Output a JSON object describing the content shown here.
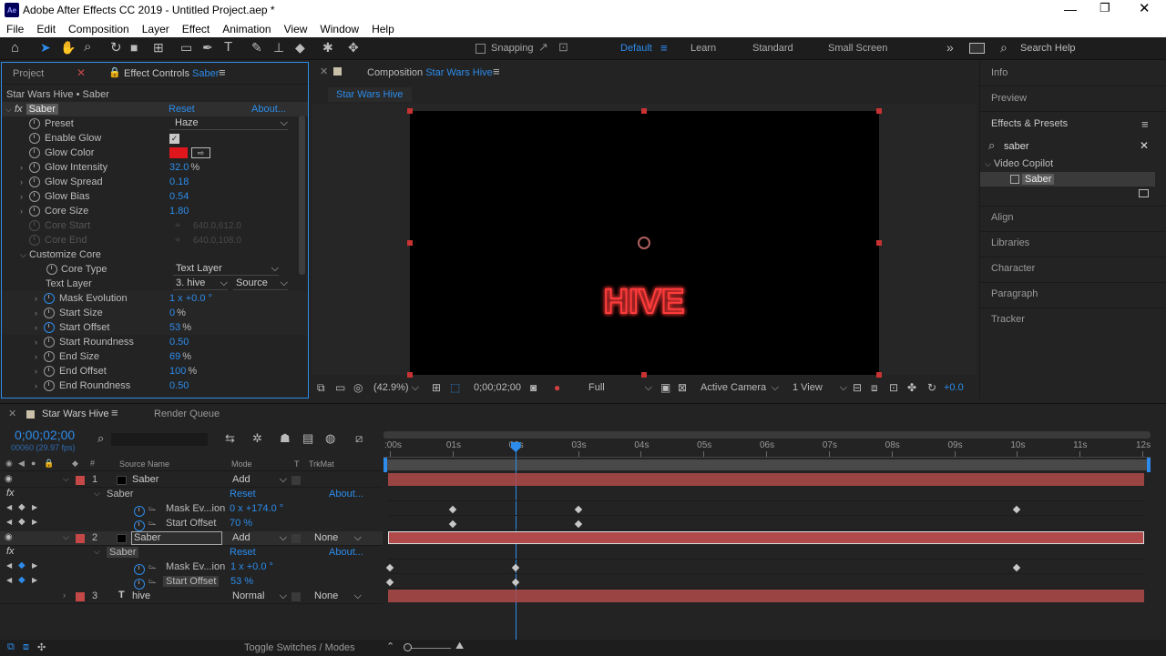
{
  "titlebar": {
    "title": "Adobe After Effects CC 2019 - Untitled Project.aep *",
    "app_icon": "Ae"
  },
  "menu": [
    "File",
    "Edit",
    "Composition",
    "Layer",
    "Effect",
    "Animation",
    "View",
    "Window",
    "Help"
  ],
  "toolbar": {
    "snapping": "Snapping",
    "workspaces": [
      "Default",
      "Learn",
      "Standard",
      "Small Screen"
    ],
    "search_placeholder": "Search Help",
    "more": "»"
  },
  "left_panel": {
    "tab_project": "Project",
    "tab_effect_controls_prefix": "Effect Controls",
    "tab_effect_controls_layer": "Saber",
    "layer_path": "Star Wars Hive • Saber",
    "effect_name": "Saber",
    "reset": "Reset",
    "about": "About...",
    "props": [
      {
        "label": "Preset",
        "value": "Haze",
        "kind": "select"
      },
      {
        "label": "Enable Glow",
        "value": "✓",
        "kind": "check"
      },
      {
        "label": "Glow Color",
        "value": "",
        "kind": "color"
      },
      {
        "label": "Glow Intensity",
        "value": "32.0",
        "unit": "%"
      },
      {
        "label": "Glow Spread",
        "value": "0.18"
      },
      {
        "label": "Glow Bias",
        "value": "0.54"
      },
      {
        "label": "Core Size",
        "value": "1.80"
      },
      {
        "label": "Core Start",
        "value": "640.0,612.0",
        "kind": "disabled"
      },
      {
        "label": "Core End",
        "value": "640.0,108.0",
        "kind": "disabled"
      }
    ],
    "customize_core": "Customize Core",
    "core_type_label": "Core Type",
    "core_type_value": "Text Layer",
    "text_layer_label": "Text Layer",
    "text_layer_value": "3. hive",
    "text_layer_source": "Source",
    "core_props": [
      {
        "label": "Mask Evolution",
        "value": "1 x +0.0 °"
      },
      {
        "label": "Start Size",
        "value": "0",
        "unit": "%"
      },
      {
        "label": "Start Offset",
        "value": "53",
        "unit": "%"
      },
      {
        "label": "Start Roundness",
        "value": "0.50"
      },
      {
        "label": "End Size",
        "value": "69",
        "unit": "%"
      },
      {
        "label": "End Offset",
        "value": "100",
        "unit": "%"
      },
      {
        "label": "End Roundness",
        "value": "0.50"
      }
    ]
  },
  "comp_panel": {
    "tab_prefix": "Composition",
    "tab_name": "Star Wars Hive",
    "flow_tab": "Star Wars Hive",
    "text": "HIVE",
    "zoom": "(42.9%)",
    "timecode": "0;00;02;00",
    "resolution": "Full",
    "camera": "Active Camera",
    "views": "1 View",
    "exposure": "+0.0"
  },
  "right_panel": {
    "info": "Info",
    "preview": "Preview",
    "effects_presets": "Effects & Presets",
    "search_value": "saber",
    "category": "Video Copilot",
    "effect_item": "Saber",
    "sections": [
      "Align",
      "Libraries",
      "Character",
      "Paragraph",
      "Tracker"
    ]
  },
  "timeline": {
    "tab": "Star Wars Hive",
    "render_queue": "Render Queue",
    "timecode": "0;00;02;00",
    "frame_info": "00060 (29.97 fps)",
    "col_source": "Source Name",
    "col_mode": "Mode",
    "col_t": "T",
    "col_trkmat": "TrkMat",
    "ruler": [
      ":00s",
      "01s",
      "02s",
      "03s",
      "04s",
      "05s",
      "06s",
      "07s",
      "08s",
      "09s",
      "10s",
      "11s",
      "12s"
    ],
    "current_time_s": 2,
    "duration_s": 12,
    "layers": [
      {
        "num": "1",
        "name": "Saber",
        "mode": "Add",
        "trkmat": "",
        "fx": "Saber",
        "reset": "Reset",
        "about": "About...",
        "props": [
          {
            "label": "Mask Ev...ion",
            "value": "0 x +174.0 °",
            "keys_s": [
              1,
              3,
              10
            ]
          },
          {
            "label": "Start Offset",
            "value": "70 %",
            "keys_s": [
              1,
              3
            ]
          }
        ]
      },
      {
        "num": "2",
        "name": "Saber",
        "mode": "Add",
        "trkmat": "None",
        "fx": "Saber",
        "reset": "Reset",
        "about": "About...",
        "props": [
          {
            "label": "Mask Ev...ion",
            "value": "1 x +0.0 °",
            "keys_s": [
              0,
              2,
              10
            ]
          },
          {
            "label": "Start Offset",
            "value": "53 %",
            "keys_s": [
              0,
              2
            ]
          }
        ]
      },
      {
        "num": "3",
        "name": "hive",
        "mode": "Normal",
        "trkmat": "None",
        "type_icon": "T"
      }
    ],
    "bottom": "Toggle Switches / Modes"
  },
  "colors": {
    "accent": "#2d8ceb",
    "layer_bar": "#b04a4a",
    "label_red": "#c54848",
    "glow_red": "#e0161d"
  }
}
